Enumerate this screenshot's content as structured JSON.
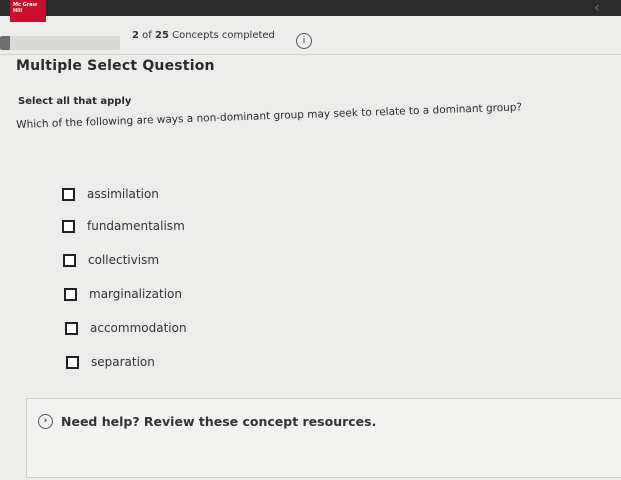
{
  "brand": {
    "logo_text": "Mc Graw Hill"
  },
  "progress": {
    "current": "2",
    "total": "25",
    "of_label": "of",
    "suffix": "Concepts completed",
    "fraction": 0.08
  },
  "question": {
    "heading": "Multiple Select Question",
    "instruction": "Select all that apply",
    "text": "Which of the following are ways a non-dominant group may seek to relate to a dominant group?",
    "options": [
      {
        "label": "assimilation",
        "checked": false
      },
      {
        "label": "fundamentalism",
        "checked": false
      },
      {
        "label": "collectivism",
        "checked": false
      },
      {
        "label": "marginalization",
        "checked": false
      },
      {
        "label": "accommodation",
        "checked": false
      },
      {
        "label": "separation",
        "checked": false
      }
    ]
  },
  "help": {
    "text": "Need help? Review these concept resources."
  },
  "icons": {
    "info": "info-icon",
    "collapse": "collapse-icon",
    "help_toggle": "chevron-right-icon"
  }
}
